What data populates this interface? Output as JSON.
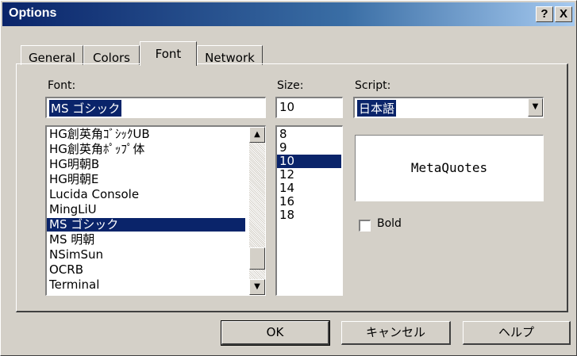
{
  "window": {
    "title": "Options",
    "help_label": "?",
    "close_label": "X"
  },
  "tabs": [
    {
      "label": "General",
      "active": false
    },
    {
      "label": "Colors",
      "active": false
    },
    {
      "label": "Font",
      "active": true
    },
    {
      "label": "Network",
      "active": false
    }
  ],
  "font": {
    "label": "Font:",
    "value": "MS ゴシック",
    "items": [
      "HG創英角ｺﾞｼｯｸUB",
      "HG創英角ﾎﾟｯﾌﾟ体",
      "HG明朝B",
      "HG明朝E",
      "Lucida Console",
      "MingLiU",
      "MS ゴシック",
      "MS 明朝",
      "NSimSun",
      "OCRB",
      "Terminal"
    ],
    "selected_index": 6
  },
  "size": {
    "label": "Size:",
    "value": "10",
    "items": [
      "8",
      "9",
      "10",
      "12",
      "14",
      "16",
      "18"
    ],
    "selected_index": 2
  },
  "script": {
    "label": "Script:",
    "value": "日本語"
  },
  "preview": {
    "text": "MetaQuotes"
  },
  "bold": {
    "label": "Bold",
    "checked": false
  },
  "buttons": {
    "ok": "OK",
    "cancel": "キャンセル",
    "help": "ヘルプ"
  },
  "icons": {
    "scroll_up": "up-arrow-icon",
    "scroll_down": "down-arrow-icon",
    "dropdown": "down-arrow-icon"
  }
}
